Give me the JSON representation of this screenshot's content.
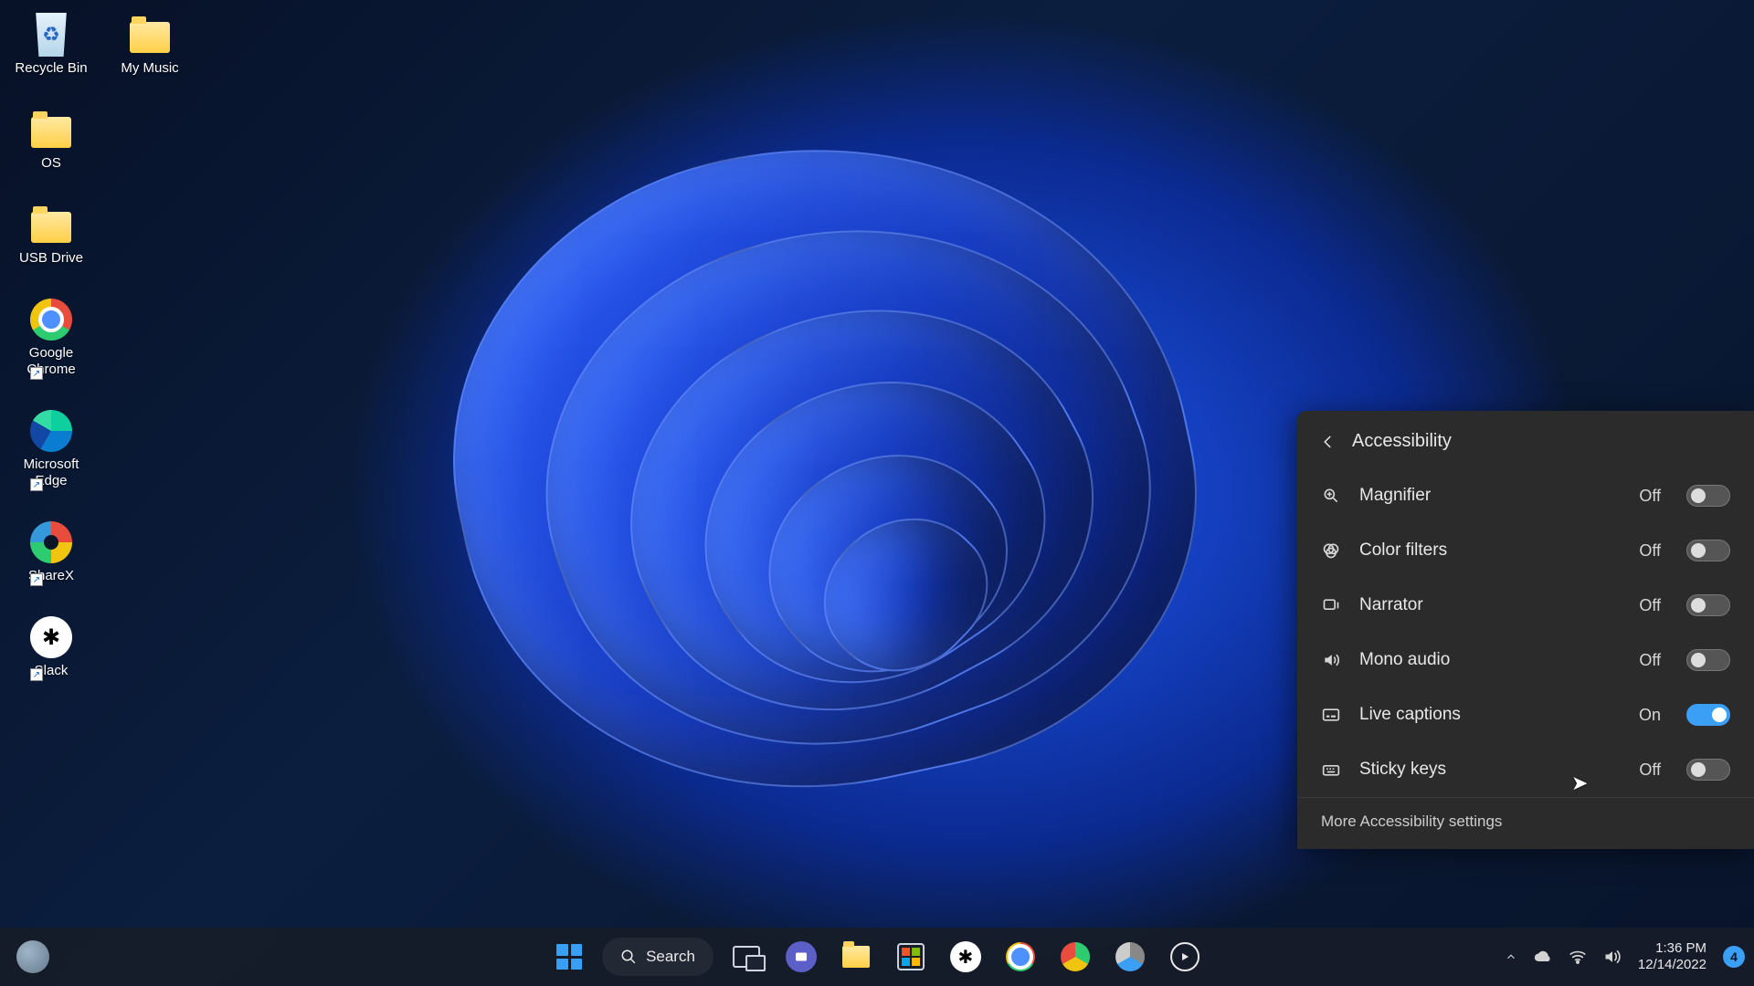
{
  "desktop_icons": [
    {
      "id": "recycle-bin",
      "label": "Recycle Bin"
    },
    {
      "id": "my-music",
      "label": "My Music"
    },
    {
      "id": "os",
      "label": "OS"
    },
    {
      "id": "usb-drive",
      "label": "USB Drive"
    },
    {
      "id": "google-chrome",
      "label": "Google\nChrome"
    },
    {
      "id": "microsoft-edge",
      "label": "Microsoft\nEdge"
    },
    {
      "id": "sharex",
      "label": "ShareX"
    },
    {
      "id": "slack",
      "label": "Slack"
    }
  ],
  "flyout": {
    "title": "Accessibility",
    "items": [
      {
        "id": "magnifier",
        "label": "Magnifier",
        "state": "Off",
        "on": false
      },
      {
        "id": "color-filters",
        "label": "Color filters",
        "state": "Off",
        "on": false
      },
      {
        "id": "narrator",
        "label": "Narrator",
        "state": "Off",
        "on": false
      },
      {
        "id": "mono-audio",
        "label": "Mono audio",
        "state": "Off",
        "on": false
      },
      {
        "id": "live-captions",
        "label": "Live captions",
        "state": "On",
        "on": true
      },
      {
        "id": "sticky-keys",
        "label": "Sticky keys",
        "state": "Off",
        "on": false
      }
    ],
    "more": "More Accessibility settings"
  },
  "taskbar": {
    "search": "Search",
    "pins": [
      {
        "id": "start",
        "name": "start-button"
      },
      {
        "id": "search",
        "name": "search-button"
      },
      {
        "id": "taskview",
        "name": "task-view-button"
      },
      {
        "id": "chat",
        "name": "chat-button"
      },
      {
        "id": "file-explorer",
        "name": "file-explorer-button"
      },
      {
        "id": "store",
        "name": "microsoft-store-button"
      },
      {
        "id": "slack",
        "name": "slack-button"
      },
      {
        "id": "chrome",
        "name": "chrome-button"
      },
      {
        "id": "chrome-canary",
        "name": "chrome-canary-button"
      },
      {
        "id": "chrome-dev",
        "name": "chrome-dev-button"
      },
      {
        "id": "media",
        "name": "media-player-button"
      }
    ]
  },
  "tray": {
    "time": "1:36 PM",
    "date": "12/14/2022",
    "notification_count": "4"
  }
}
